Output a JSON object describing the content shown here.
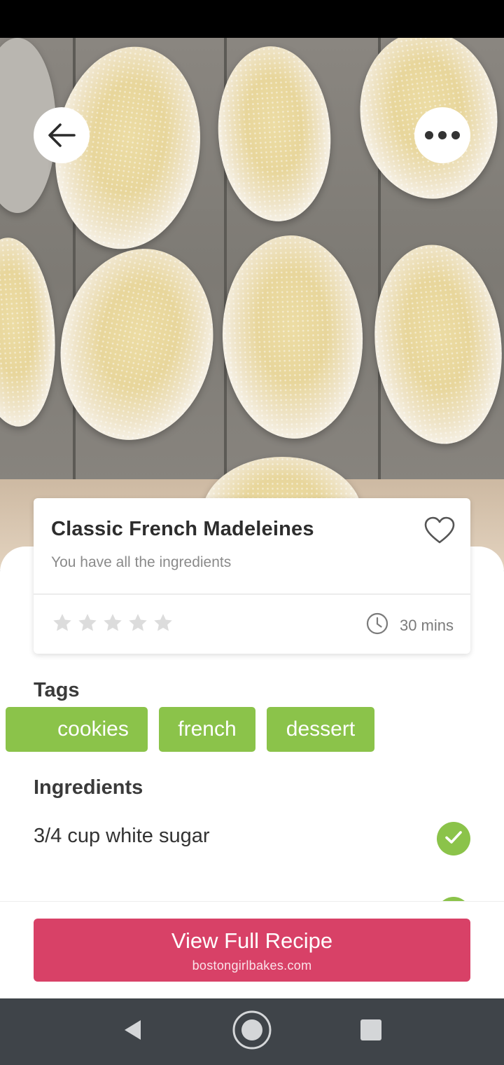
{
  "icons": {
    "back": "arrow-left-icon",
    "more": "more-horizontal-icon",
    "favorite": "heart-icon",
    "rating_star": "star-icon",
    "time": "clock-icon",
    "ingredient_available": "check-icon",
    "nav_back": "triangle-back-icon",
    "nav_home": "circle-home-icon",
    "nav_recents": "square-recents-icon"
  },
  "colors": {
    "tag_green": "#8bc34a",
    "check_green": "#8bc34a",
    "cta_pink": "#d84167",
    "nav_bar": "#3f4449",
    "star_empty": "#dcdcdc"
  },
  "recipe": {
    "title": "Classic French Madeleines",
    "subtitle": "You have all the ingredients",
    "rating": 0,
    "rating_max": 5,
    "time": "30 mins"
  },
  "tags": {
    "heading": "Tags",
    "items": [
      "cookies",
      "french",
      "dessert"
    ]
  },
  "ingredients": {
    "heading": "Ingredients",
    "items": [
      {
        "text": "3/4 cup white sugar",
        "available": true
      }
    ]
  },
  "cta": {
    "label": "View Full Recipe",
    "source": "bostongirlbakes.com"
  }
}
